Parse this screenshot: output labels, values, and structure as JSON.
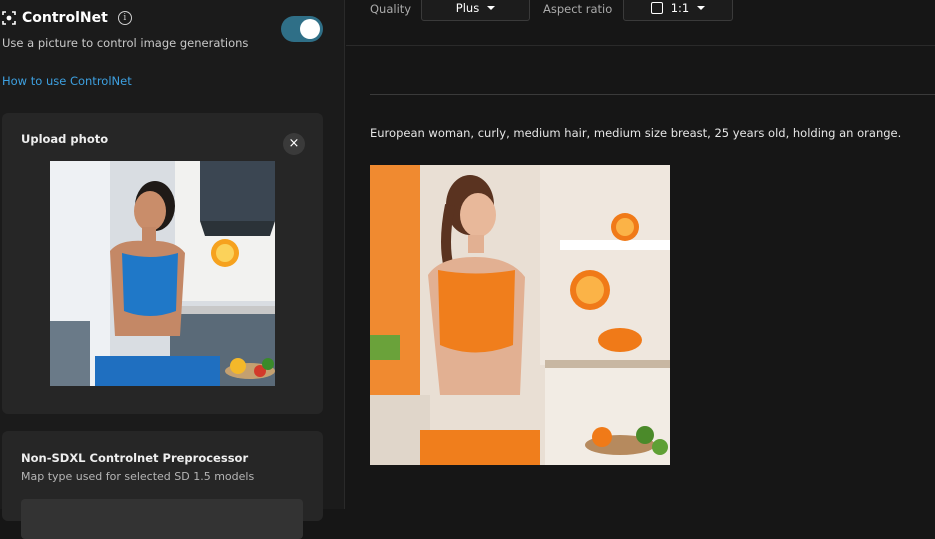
{
  "sidebar": {
    "controlnet": {
      "title": "ControlNet",
      "description": "Use a picture to control image generations",
      "enabled": true,
      "help_link": "How to use ControlNet"
    },
    "upload": {
      "title": "Upload photo",
      "close_label": "×"
    },
    "preprocessor": {
      "title": "Non-SDXL Controlnet Preprocessor",
      "description": "Map type used for selected SD 1.5 models"
    }
  },
  "toolbar": {
    "quality_label": "Quality",
    "quality_value": "Plus",
    "aspect_label": "Aspect ratio",
    "aspect_value": "1:1"
  },
  "result": {
    "prompt": "European woman, curly, medium hair, medium size breast, 25 years old, holding an orange."
  },
  "colors": {
    "accent_link": "#3da0e0",
    "toggle_on": "#2f6f87",
    "background": "#161616"
  }
}
